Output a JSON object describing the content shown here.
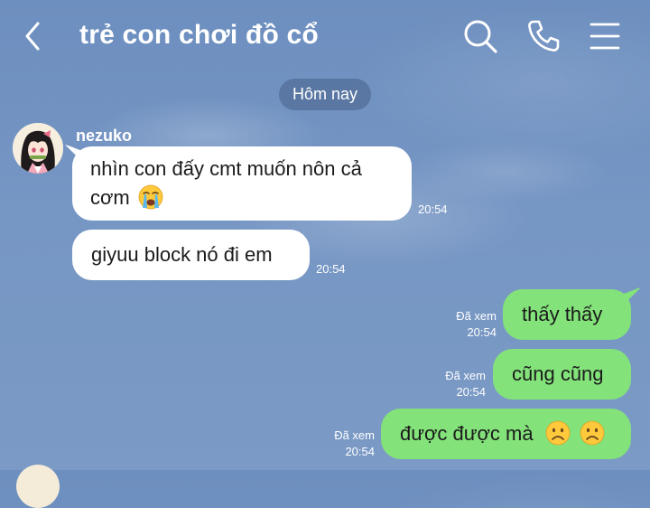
{
  "header": {
    "title": "trẻ con chơi đồ cổ",
    "icons": [
      "chevron-left-icon",
      "search-icon",
      "phone-icon",
      "menu-icon"
    ]
  },
  "date_divider": "Hôm nay",
  "sender": {
    "name": "nezuko"
  },
  "messages": [
    {
      "direction": "incoming",
      "text": "nhìn con đấy cmt muốn nôn cả cơm",
      "emoji": "loudly-crying-face",
      "time": "20:54"
    },
    {
      "direction": "incoming",
      "text": "giyuu block nó đi em",
      "time": "20:54"
    },
    {
      "direction": "outgoing",
      "text": "thấy thấy",
      "status": "Đã xem",
      "time": "20:54"
    },
    {
      "direction": "outgoing",
      "text": "cũng cũng",
      "status": "Đã xem",
      "time": "20:54"
    },
    {
      "direction": "outgoing",
      "text": "được được mà",
      "emoji": "frowning-face frowning-face",
      "status": "Đã xem",
      "time": "20:54"
    }
  ],
  "colors": {
    "background": "#7696c4",
    "incoming_bubble": "#ffffff",
    "outgoing_bubble": "#83e27a",
    "date_pill": "#5a7aa4"
  }
}
